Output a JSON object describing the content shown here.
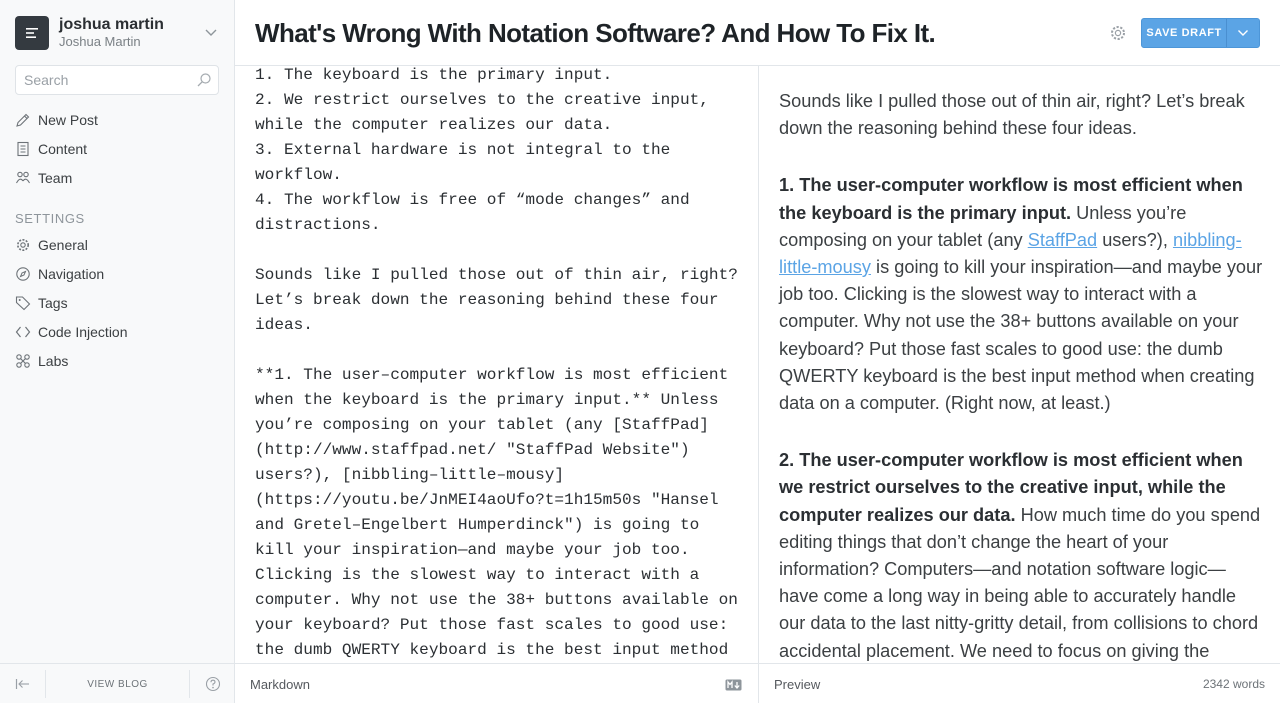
{
  "blog": {
    "title": "joshua martin",
    "user": "Joshua Martin"
  },
  "search": {
    "placeholder": "Search"
  },
  "nav": [
    {
      "label": "New Post",
      "icon": "pencil-icon"
    },
    {
      "label": "Content",
      "icon": "document-icon"
    },
    {
      "label": "Team",
      "icon": "users-icon"
    }
  ],
  "settings": {
    "heading": "SETTINGS",
    "items": [
      {
        "label": "General",
        "icon": "gear-icon"
      },
      {
        "label": "Navigation",
        "icon": "compass-icon"
      },
      {
        "label": "Tags",
        "icon": "tag-icon"
      },
      {
        "label": "Code Injection",
        "icon": "code-icon"
      },
      {
        "label": "Labs",
        "icon": "labs-icon"
      }
    ]
  },
  "sidebar_footer": {
    "view_blog": "VIEW BLOG"
  },
  "header": {
    "title": "What's Wrong With Notation Software? And How To Fix It.",
    "save_label": "SAVE DRAFT"
  },
  "markdown": {
    "text": "1. The keyboard is the primary input.\n2. We restrict ourselves to the creative input,\nwhile the computer realizes our data.\n3. External hardware is not integral to the\nworkflow.\n4. The workflow is free of “mode changes” and\ndistractions.\n\nSounds like I pulled those out of thin air, right?\nLet’s break down the reasoning behind these four\nideas.\n\n**1. The user–computer workflow is most efficient\nwhen the keyboard is the primary input.** Unless\nyou’re composing on your tablet (any [StaffPad]\n(http://www.staffpad.net/ \"StaffPad Website\")\nusers?), [nibbling–little–mousy]\n(https://youtu.be/JnMEI4aoUfo?t=1h15m50s \"Hansel\nand Gretel–Engelbert Humperdinck\") is going to\nkill your inspiration—and maybe your job too.\nClicking is the slowest way to interact with a\ncomputer. Why not use the 38+ buttons available on\nyour keyboard? Put those fast scales to good use:\nthe dumb QWERTY keyboard is the best input method\nwhen creating data on a computer. (Right now, at\nleast.)"
  },
  "preview": {
    "p1": "Sounds like I pulled those out of thin air, right? Let’s break down the reasoning behind these four ideas.",
    "p2_bold": "1. The user-computer workflow is most efficient when the keyboard is the primary input.",
    "p2_a": " Unless you’re composing on your tablet (any ",
    "p2_link1": "StaffPad",
    "p2_b": " users?), ",
    "p2_link2": "nibbling-little-mousy",
    "p2_c": " is going to kill your inspiration—and maybe your job too. Clicking is the slowest way to interact with a computer. Why not use the 38+ buttons available on your keyboard? Put those fast scales to good use: the dumb QWERTY keyboard is the best input method when creating data on a computer. (Right now, at least.)",
    "p3_bold": "2. The user-computer workflow is most efficient when we restrict ourselves to the creative input, while the computer realizes our data.",
    "p3_a": " How much time do you spend editing things that don’t change the heart of your information? Computers—and notation software logic—have come a long way in being able to accurately handle our data to the last nitty-gritty detail, from collisions to chord accidental placement. We need to focus on giving the computer the creative input it needs."
  },
  "footer": {
    "markdown_label": "Markdown",
    "preview_label": "Preview",
    "word_count": "2342 words"
  },
  "colors": {
    "accent": "#5ba4e5",
    "sidebar_bg": "#f8f9fa",
    "blog_icon_bg": "#343a40"
  }
}
